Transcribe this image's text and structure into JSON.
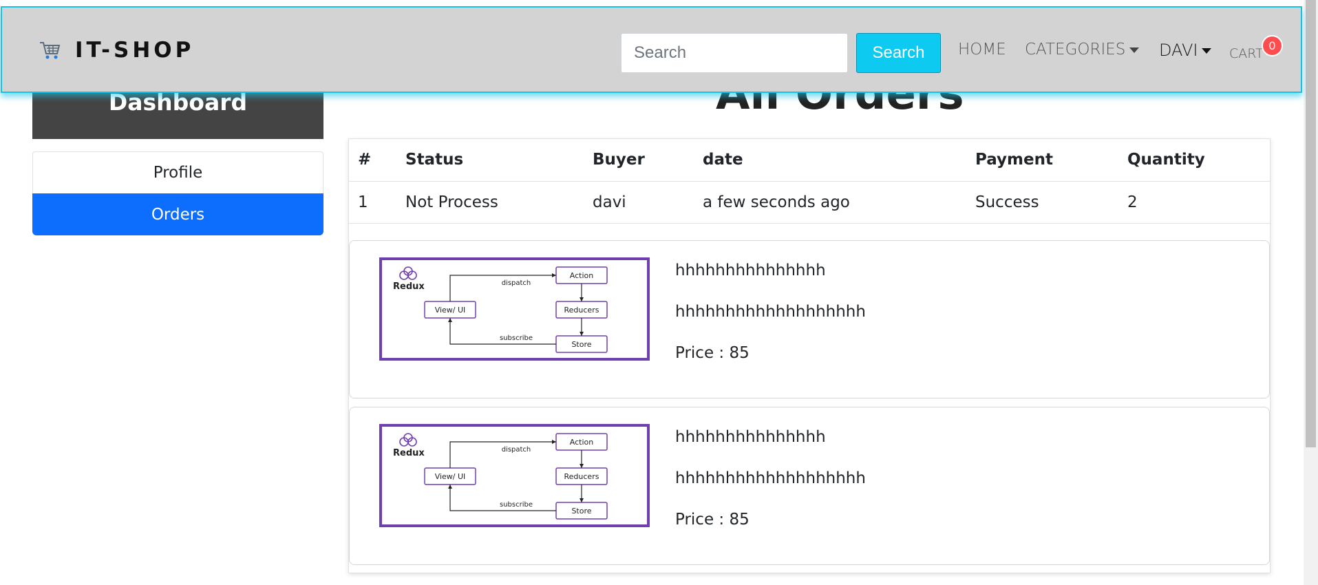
{
  "navbar": {
    "brand": "IT-SHOP",
    "search_placeholder": "Search",
    "search_button": "Search",
    "links": {
      "home": "HOME",
      "categories": "CATEGORIES",
      "user": "DAVI",
      "cart": "CART"
    },
    "cart_count": "0"
  },
  "sidebar": {
    "title": "Dashboard",
    "items": [
      {
        "label": "Profile",
        "active": false
      },
      {
        "label": "Orders",
        "active": true
      }
    ]
  },
  "main": {
    "title": "All Orders",
    "table": {
      "headers": [
        "#",
        "Status",
        "Buyer",
        "date",
        "Payment",
        "Quantity"
      ],
      "rows": [
        [
          "1",
          "Not Process",
          "davi",
          "a few seconds ago",
          "Success",
          "2"
        ]
      ]
    },
    "products": [
      {
        "name": "hhhhhhhhhhhhhhh",
        "description": "hhhhhhhhhhhhhhhhhhh",
        "price": "Price : 85",
        "image_labels": {
          "logo": "Redux",
          "action": "Action",
          "view": "View/ UI",
          "reducers": "Reducers",
          "store": "Store",
          "dispatch": "dispatch",
          "subscribe": "subscribe"
        }
      },
      {
        "name": "hhhhhhhhhhhhhhh",
        "description": "hhhhhhhhhhhhhhhhhhh",
        "price": "Price : 85",
        "image_labels": {
          "logo": "Redux",
          "action": "Action",
          "view": "View/ UI",
          "reducers": "Reducers",
          "store": "Store",
          "dispatch": "dispatch",
          "subscribe": "subscribe"
        }
      }
    ]
  },
  "colors": {
    "navbar_bg": "#d3d3d3",
    "navbar_border": "#17c1e8",
    "search_button": "#0dcaf0",
    "active_item": "#0d6efd",
    "dashboard_header": "#444444",
    "badge": "#ff4d4f",
    "image_border": "#6f3fb0"
  },
  "icons": {
    "brand": "cart-icon",
    "dropdown": "chevron-down-icon"
  }
}
